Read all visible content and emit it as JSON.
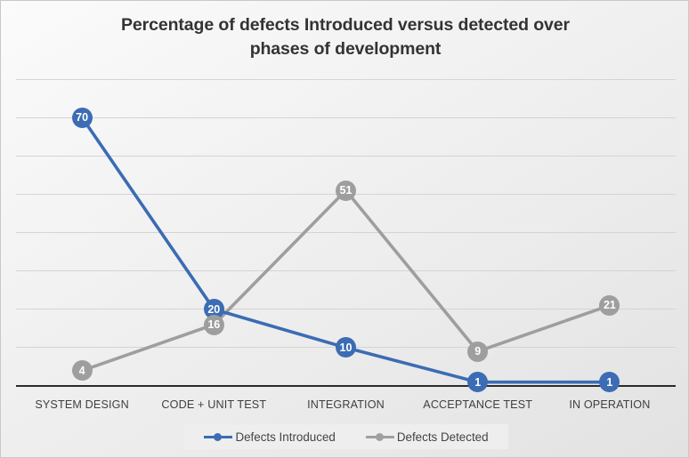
{
  "chart_data": {
    "type": "line",
    "title": "Percentage of defects Introduced versus detected over phases of development",
    "title_line1": "Percentage of defects Introduced versus detected over",
    "title_line2": "phases of development",
    "xlabel": "",
    "ylabel": "",
    "ylim": [
      0,
      80
    ],
    "grid": true,
    "legend_position": "bottom",
    "categories": [
      "SYSTEM DESIGN",
      "CODE + UNIT TEST",
      "INTEGRATION",
      "ACCEPTANCE TEST",
      "IN OPERATION"
    ],
    "series": [
      {
        "name": "Defects Introduced",
        "color": "#3b6cb4",
        "values": [
          70,
          20,
          10,
          1,
          1
        ]
      },
      {
        "name": "Defects Detected",
        "color": "#9e9e9e",
        "values": [
          4,
          16,
          51,
          9,
          21
        ]
      }
    ]
  },
  "legend": {
    "items": [
      {
        "label": "Defects Introduced",
        "icon": "line-marker-icon"
      },
      {
        "label": "Defects Detected",
        "icon": "line-marker-icon"
      }
    ]
  },
  "colors": {
    "introduced": "#3b6cb4",
    "detected": "#9e9e9e",
    "gridline": "#d4d4d4",
    "axis": "#2b2b2b",
    "title_text": "#333333"
  }
}
